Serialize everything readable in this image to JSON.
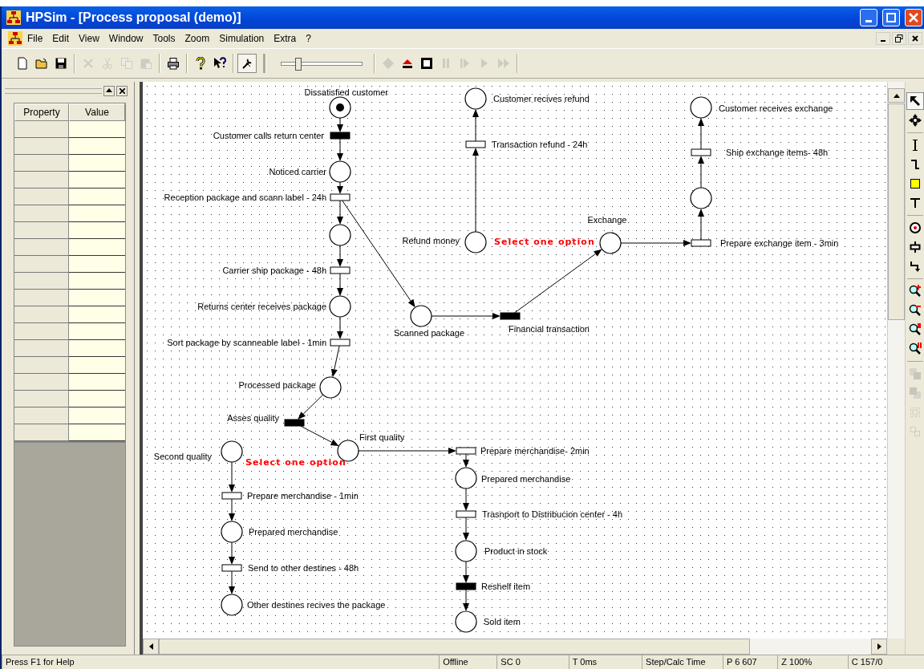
{
  "window": {
    "title": "HPSim - [Process proposal (demo)]"
  },
  "menu": [
    "File",
    "Edit",
    "View",
    "Window",
    "Tools",
    "Zoom",
    "Simulation",
    "Extra",
    "?"
  ],
  "toolbar": {
    "buttons": [
      {
        "kind": "new",
        "disabled": false,
        "pressed": false
      },
      {
        "kind": "open",
        "disabled": false,
        "pressed": false
      },
      {
        "kind": "save",
        "disabled": false,
        "pressed": false
      },
      {
        "kind": "delete",
        "disabled": true,
        "pressed": false
      },
      {
        "kind": "cut",
        "disabled": true,
        "pressed": false
      },
      {
        "kind": "copy",
        "disabled": true,
        "pressed": false
      },
      {
        "kind": "paste",
        "disabled": true,
        "pressed": false
      },
      {
        "kind": "print",
        "disabled": false,
        "pressed": false
      },
      {
        "kind": "help",
        "disabled": false,
        "pressed": false
      },
      {
        "kind": "context-help",
        "disabled": false,
        "pressed": false
      },
      {
        "kind": "options",
        "disabled": false,
        "pressed": true
      }
    ],
    "speed": {
      "level": 0.2
    },
    "sim_buttons": [
      {
        "kind": "reset",
        "disabled": true
      },
      {
        "kind": "eject",
        "disabled": false
      },
      {
        "kind": "stop",
        "disabled": false
      },
      {
        "kind": "pause",
        "disabled": true
      },
      {
        "kind": "step",
        "disabled": true
      },
      {
        "kind": "play",
        "disabled": true
      },
      {
        "kind": "fast",
        "disabled": true
      }
    ]
  },
  "properties": {
    "columns": [
      "Property",
      "Value"
    ]
  },
  "diagram": {
    "nodes": [
      {
        "kind": "place",
        "label": "Dissatisfied customer",
        "marked": true
      },
      {
        "kind": "place",
        "label": "Customer recives refund",
        "marked": false
      },
      {
        "kind": "place",
        "label": "Customer receives exchange",
        "marked": false
      },
      {
        "kind": "immediate",
        "label": "Customer calls return center"
      },
      {
        "kind": "timed",
        "label": "Transaction refund - 24h"
      },
      {
        "kind": "timed",
        "label": "Ship exchange items- 48h"
      },
      {
        "kind": "place",
        "label": "Noticed carrier",
        "marked": false
      },
      {
        "kind": "place",
        "marked": false
      },
      {
        "kind": "timed",
        "label": "Reception package and scann label - 24h"
      },
      {
        "kind": "place",
        "label": "Exchange",
        "marked": false
      },
      {
        "kind": "place",
        "marked": false
      },
      {
        "kind": "place",
        "label": "Refund money",
        "marked": false
      },
      {
        "kind": "timed",
        "label": "Prepare exchange item - 3min"
      },
      {
        "kind": "timed",
        "label": "Carrier ship package - 48h"
      },
      {
        "kind": "place",
        "label": "Returns center receives package",
        "marked": false
      },
      {
        "kind": "place",
        "label": "Scanned package",
        "marked": false
      },
      {
        "kind": "immediate",
        "label": "Financial transaction"
      },
      {
        "kind": "timed",
        "label": "Sort package by scanneable label - 1min"
      },
      {
        "kind": "place",
        "label": "Processed package",
        "marked": false
      },
      {
        "kind": "immediate",
        "label": "Asses quality"
      },
      {
        "kind": "place",
        "label": "First quality",
        "marked": false
      },
      {
        "kind": "place",
        "label": "Second quality",
        "marked": false
      },
      {
        "kind": "timed",
        "label": "Prepare merchandise- 2min"
      },
      {
        "kind": "place",
        "label": "Prepared merchandise",
        "marked": false
      },
      {
        "kind": "timed",
        "label": "Prepare merchandise - 1min"
      },
      {
        "kind": "timed",
        "label": "Trasnport to Distribucion center - 4h"
      },
      {
        "kind": "place",
        "label": "Prepared merchandise",
        "marked": false
      },
      {
        "kind": "place",
        "label": "Product in stock",
        "marked": false
      },
      {
        "kind": "timed",
        "label": "Send to other destines - 48h"
      },
      {
        "kind": "immediate",
        "label": "Reshelf item"
      },
      {
        "kind": "place",
        "label": "Other destines recives the package",
        "marked": false
      },
      {
        "kind": "place",
        "label": "Sold item",
        "marked": false
      }
    ],
    "notes": [
      "Select one option",
      "Select one option"
    ]
  },
  "tools": [
    {
      "kind": "select",
      "selected": true,
      "disabled": false
    },
    {
      "kind": "move",
      "selected": false,
      "disabled": false
    },
    {
      "kind": "line",
      "selected": false,
      "disabled": false
    },
    {
      "kind": "corner",
      "selected": false,
      "disabled": false
    },
    {
      "kind": "rectangle",
      "selected": false,
      "disabled": false
    },
    {
      "kind": "text",
      "selected": false,
      "disabled": false
    },
    {
      "kind": "place",
      "selected": false,
      "disabled": false
    },
    {
      "kind": "transition",
      "selected": false,
      "disabled": false
    },
    {
      "kind": "arc",
      "selected": false,
      "disabled": false
    },
    {
      "kind": "zoom-in",
      "selected": false,
      "disabled": false
    },
    {
      "kind": "zoom-out",
      "selected": false,
      "disabled": false
    },
    {
      "kind": "zoom-page",
      "selected": false,
      "disabled": false
    },
    {
      "kind": "zoom-all",
      "selected": false,
      "disabled": false
    },
    {
      "kind": "front",
      "selected": false,
      "disabled": true
    },
    {
      "kind": "back",
      "selected": false,
      "disabled": true
    },
    {
      "kind": "group",
      "selected": false,
      "disabled": true
    },
    {
      "kind": "ungroup",
      "selected": false,
      "disabled": true
    }
  ],
  "status_bar": [
    "Press F1 for Help",
    "Offline",
    "SC 0",
    "T 0ms",
    "Step/Calc Time",
    "P 6 607",
    "Z 100%",
    "C 157/0"
  ]
}
